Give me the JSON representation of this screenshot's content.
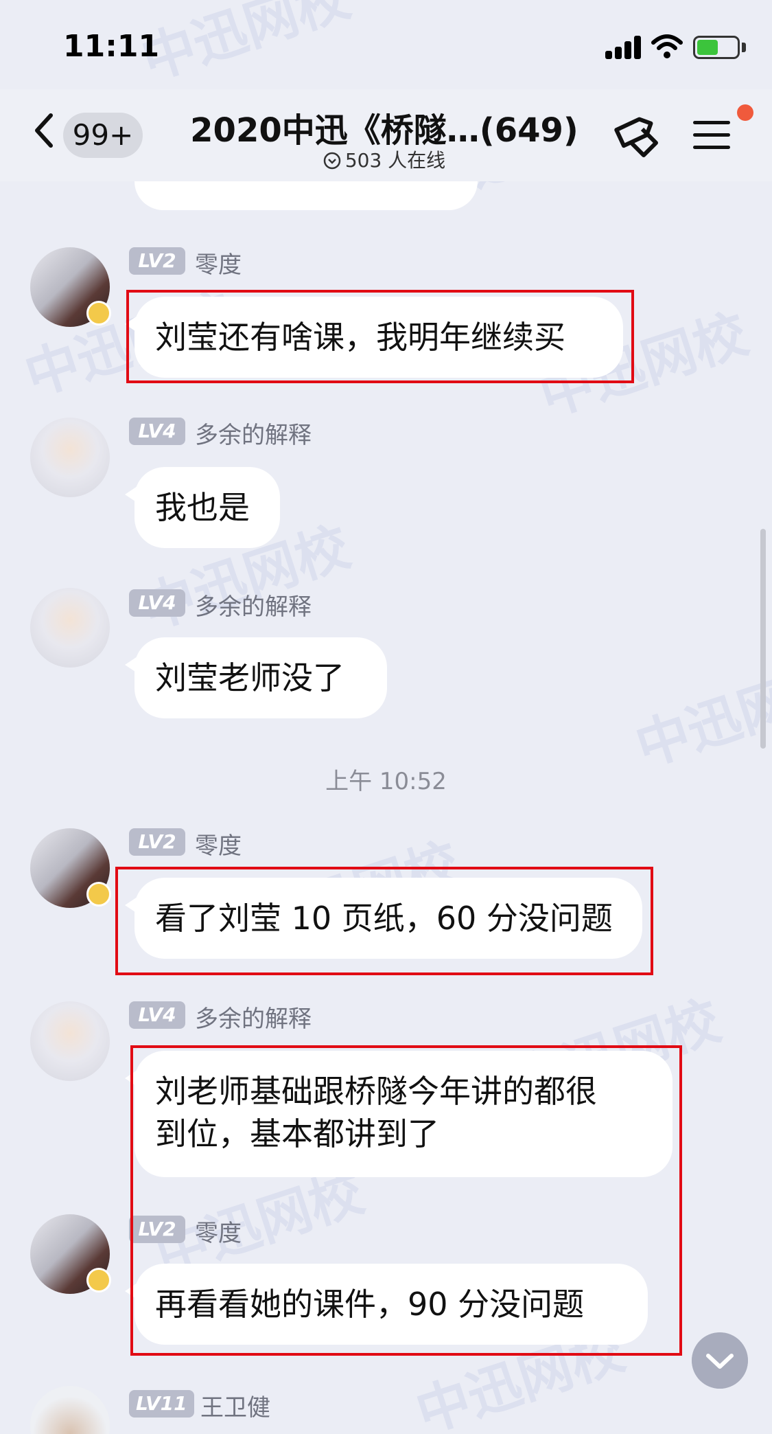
{
  "status_bar": {
    "time": "11:11"
  },
  "nav": {
    "unread_count": "99+",
    "title": "2020中迅《桥隧…(649)",
    "online": "503 人在线"
  },
  "time_divider": "上午 10:52",
  "messages": [
    {
      "level": "LV2",
      "sender": "零度",
      "text": "刘莹还有啥课，我明年继续买"
    },
    {
      "level": "LV4",
      "sender": "多余的解释",
      "text": "我也是"
    },
    {
      "level": "LV4",
      "sender": "多余的解释",
      "text": "刘莹老师没了"
    },
    {
      "level": "LV2",
      "sender": "零度",
      "text": "看了刘莹 10 页纸，60 分没问题"
    },
    {
      "level": "LV4",
      "sender": "多余的解释",
      "text_line1": "刘老师基础跟桥隧今年讲的都很",
      "text_line2": "到位，基本都讲到了"
    },
    {
      "level": "LV2",
      "sender": "零度",
      "text": "再看看她的课件，90 分没问题"
    },
    {
      "level": "LV11",
      "sender": "王卫健"
    }
  ],
  "watermark": "中迅网校",
  "colors": {
    "background": "#ebedf5",
    "highlight_box": "#e10b14",
    "level_badge": "#b9bccb",
    "unread_dot": "#f05a3c"
  }
}
